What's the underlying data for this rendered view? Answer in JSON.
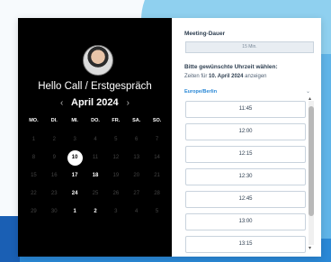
{
  "profile": {
    "title": "Hello Call / Erstgespräch"
  },
  "calendar": {
    "month_label": "April 2024",
    "prev_icon": "chevron-left-icon",
    "next_icon": "chevron-right-icon",
    "weekdays": [
      "MO.",
      "DI.",
      "MI.",
      "DO.",
      "FR.",
      "SA.",
      "SO."
    ],
    "rows": [
      [
        {
          "d": "1",
          "s": "dim"
        },
        {
          "d": "2",
          "s": "dim"
        },
        {
          "d": "3",
          "s": "dim"
        },
        {
          "d": "4",
          "s": "dim"
        },
        {
          "d": "5",
          "s": "dim"
        },
        {
          "d": "6",
          "s": "dim"
        },
        {
          "d": "7",
          "s": "dim"
        }
      ],
      [
        {
          "d": "8",
          "s": "dim"
        },
        {
          "d": "9",
          "s": "dim"
        },
        {
          "d": "10",
          "s": "selected"
        },
        {
          "d": "11",
          "s": "dim"
        },
        {
          "d": "12",
          "s": "dim"
        },
        {
          "d": "13",
          "s": "dim"
        },
        {
          "d": "14",
          "s": "dim"
        }
      ],
      [
        {
          "d": "15",
          "s": "dim"
        },
        {
          "d": "16",
          "s": "dim"
        },
        {
          "d": "17",
          "s": "available"
        },
        {
          "d": "18",
          "s": "available"
        },
        {
          "d": "19",
          "s": "dim"
        },
        {
          "d": "20",
          "s": "dim"
        },
        {
          "d": "21",
          "s": "dim"
        }
      ],
      [
        {
          "d": "22",
          "s": "dim"
        },
        {
          "d": "23",
          "s": "dim"
        },
        {
          "d": "24",
          "s": "available"
        },
        {
          "d": "25",
          "s": "dim"
        },
        {
          "d": "26",
          "s": "dim"
        },
        {
          "d": "27",
          "s": "dim"
        },
        {
          "d": "28",
          "s": "dim"
        }
      ],
      [
        {
          "d": "29",
          "s": "dim"
        },
        {
          "d": "30",
          "s": "dim"
        },
        {
          "d": "1",
          "s": "available"
        },
        {
          "d": "2",
          "s": "available"
        },
        {
          "d": "3",
          "s": "dim"
        },
        {
          "d": "4",
          "s": "dim"
        },
        {
          "d": "5",
          "s": "dim"
        }
      ]
    ]
  },
  "booking": {
    "duration_label": "Meeting-Dauer",
    "duration_value": "15 Min.",
    "time_label": "Bitte gewünschte Uhrzeit wählen:",
    "times_prefix": "Zeiten für ",
    "times_date": "10. April 2024",
    "times_suffix": " anzeigen",
    "timezone": "Europe/Berlin",
    "slots": [
      "11:45",
      "12:00",
      "12:15",
      "12:30",
      "12:45",
      "13:00",
      "13:15"
    ]
  },
  "colors": {
    "accent": "#2a88d6",
    "calendar_bg": "#000000"
  }
}
